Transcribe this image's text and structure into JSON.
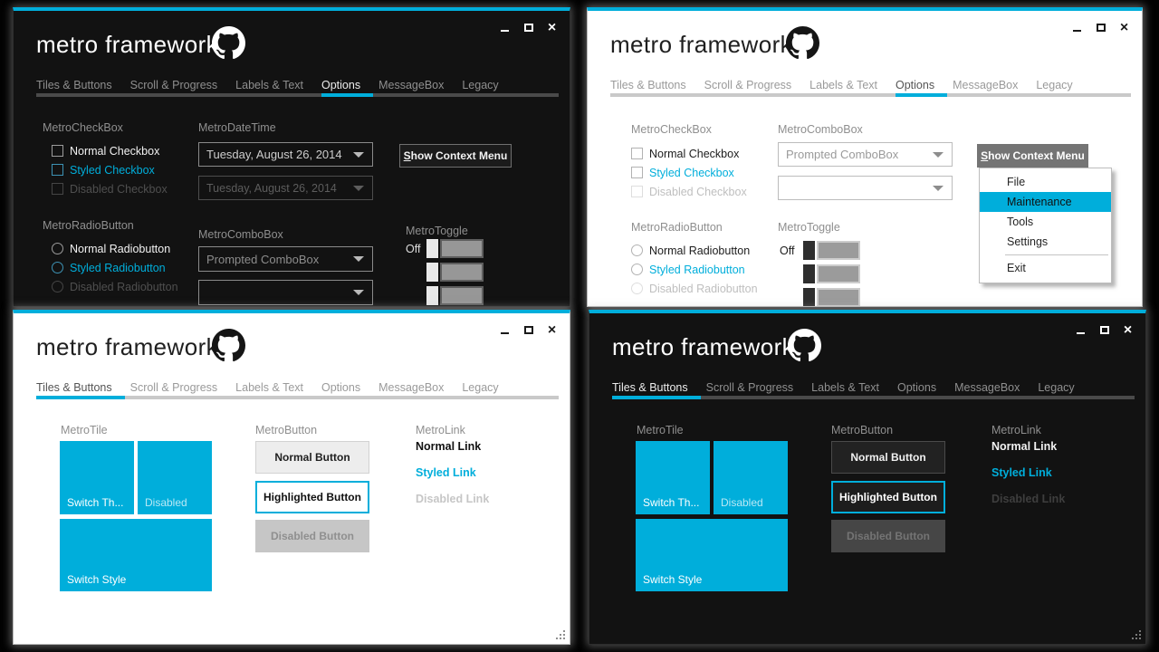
{
  "colors": {
    "accent": "#00aedb",
    "dark_bg": "#121212",
    "light_bg": "#ffffff"
  },
  "common": {
    "title": "metro framework",
    "tabs": [
      "Tiles & Buttons",
      "Scroll & Progress",
      "Labels & Text",
      "Options",
      "MessageBox",
      "Legacy"
    ],
    "controls": {
      "close": "×"
    }
  },
  "options_page": {
    "checkbox": {
      "label": "MetroCheckBox",
      "normal": "Normal Checkbox",
      "styled": "Styled Checkbox",
      "disabled": "Disabled Checkbox"
    },
    "radio": {
      "label": "MetroRadioButton",
      "normal": "Normal Radiobutton",
      "styled": "Styled Radiobutton",
      "disabled": "Disabled Radiobutton"
    },
    "datetime": {
      "label": "MetroDateTime",
      "value": "Tuesday, August 26, 2014",
      "value_disabled": "Tuesday, August 26, 2014"
    },
    "combobox": {
      "label": "MetroComboBox",
      "prompt": "Prompted ComboBox",
      "empty": ""
    },
    "toggle": {
      "label": "MetroToggle",
      "off": "Off"
    },
    "context_button": {
      "mnemonic": "S",
      "rest": "how Context Menu"
    },
    "context_menu": {
      "items": [
        "File",
        "Maintenance",
        "Tools",
        "Settings",
        "Exit"
      ],
      "highlighted": "Maintenance"
    }
  },
  "tiles_page": {
    "tile": {
      "label": "MetroTile",
      "switch_theme": "Switch Th...",
      "disabled": "Disabled",
      "switch_style": "Switch Style"
    },
    "button": {
      "label": "MetroButton",
      "normal": "Normal Button",
      "highlighted": "Highlighted Button",
      "disabled": "Disabled Button"
    },
    "link": {
      "label": "MetroLink",
      "normal": "Normal Link",
      "styled": "Styled Link",
      "disabled": "Disabled Link"
    }
  }
}
